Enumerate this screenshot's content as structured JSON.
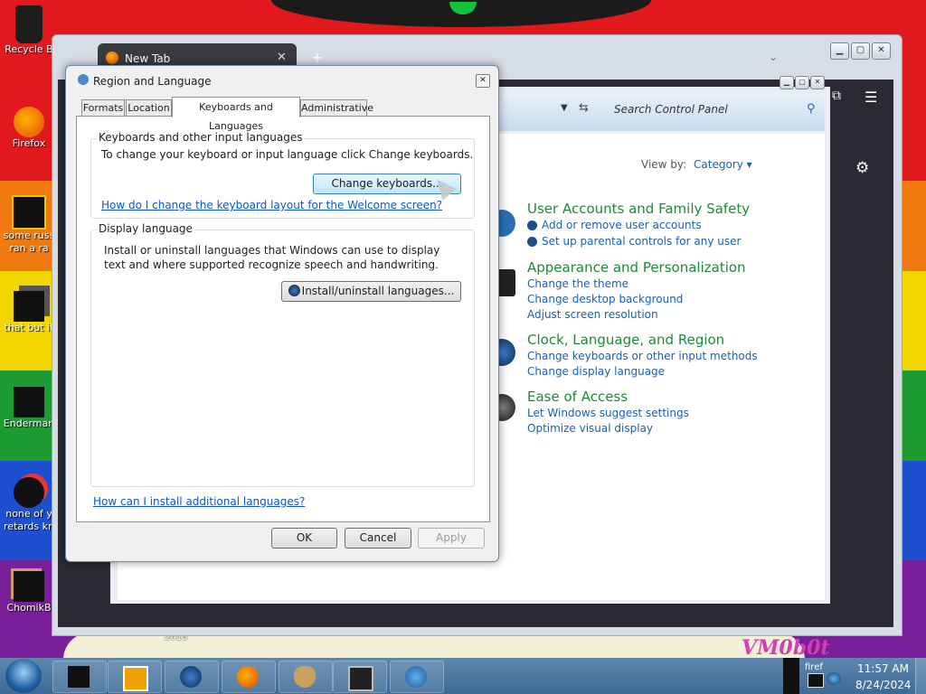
{
  "desktop": {
    "icons": [
      {
        "label": "Recycle B"
      },
      {
        "label": "Firefox"
      },
      {
        "label": "some russ"
      },
      {
        "label": "ran a ra"
      },
      {
        "label": "that but it"
      },
      {
        "label": "Enderman"
      },
      {
        "label": "none of y"
      },
      {
        "label": "retards kn"
      },
      {
        "label": "ChomikB"
      }
    ],
    "wallpaper_text": "VM0b0t",
    "wallpaper_year": "2015"
  },
  "browser": {
    "tab_title": "New Tab",
    "tab_close": "✕",
    "new_tab": "+",
    "menu_icon": "☰",
    "gear_icon": "⚙"
  },
  "control_panel": {
    "search_placeholder": "Search Control Panel",
    "view_by_label": "View by:",
    "view_by_value": "Category ▾",
    "categories": [
      {
        "title": "User Accounts and Family Safety",
        "links": [
          "Add or remove user accounts",
          "Set up parental controls for any user"
        ]
      },
      {
        "title": "Appearance and Personalization",
        "links": [
          "Change the theme",
          "Change desktop background",
          "Adjust screen resolution"
        ]
      },
      {
        "title": "Clock, Language, and Region",
        "links": [
          "Change keyboards or other input methods",
          "Change display language"
        ]
      },
      {
        "title": "Ease of Access",
        "links": [
          "Let Windows suggest settings",
          "Optimize visual display"
        ]
      }
    ]
  },
  "dialog": {
    "title": "Region and Language",
    "tabs": [
      "Formats",
      "Location",
      "Keyboards and Languages",
      "Administrative"
    ],
    "keyboards_group": {
      "title": "Keyboards and other input languages",
      "text": "To change your keyboard or input language click Change keyboards.",
      "button": "Change keyboards...",
      "link": "How do I change the keyboard layout for the Welcome screen?"
    },
    "display_group": {
      "title": "Display language",
      "text": "Install or uninstall languages that Windows can use to display text and where supported recognize speech and handwriting.",
      "button": "Install/uninstall languages..."
    },
    "bottom_link": "How can I install additional languages?",
    "buttons": {
      "ok": "OK",
      "cancel": "Cancel",
      "apply": "Apply"
    }
  },
  "taskbar": {
    "tray_text": "firef",
    "time": "11:57 AM",
    "date": "8/24/2024"
  },
  "colors": {
    "link": "#1a5fb4",
    "category_heading": "#1b8a3a",
    "taskbar": "#4a76a0"
  }
}
